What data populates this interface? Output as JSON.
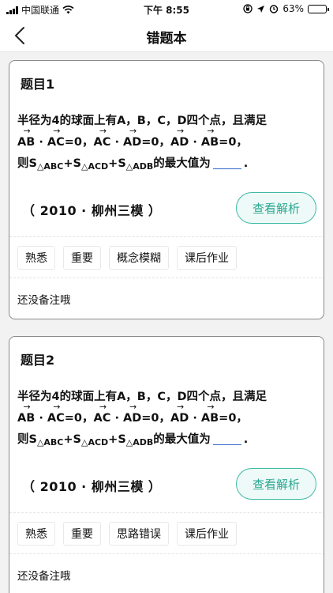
{
  "status_bar": {
    "carrier": "中国联通",
    "time": "下午 8:55",
    "battery": "63%",
    "battery_level": 0.63
  },
  "nav": {
    "title": "错题本",
    "back_icon": "chevron-left-icon"
  },
  "questions": [
    {
      "title": "题目1",
      "line1": "半径为4的球面上有A，B，C，D四个点，且满足",
      "s_prefix": "则S",
      "s_plus": "+S",
      "tri_abc": "△ABC",
      "tri_acd": "△ACD",
      "tri_adb": "△ADB",
      "s_suffix": "的最大值为",
      "period": ".",
      "source": "（ 2010 · 柳州三模 ）",
      "button": "查看解析",
      "tags": [
        "熟悉",
        "重要",
        "概念模糊",
        "课后作业"
      ],
      "note": "还没备注哦"
    },
    {
      "title": "题目2",
      "line1": "半径为4的球面上有A，B，C，D四个点，且满足",
      "s_prefix": "则S",
      "s_plus": "+S",
      "tri_abc": "△ABC",
      "tri_acd": "△ACD",
      "tri_adb": "△ADB",
      "s_suffix": "的最大值为",
      "period": ".",
      "source": "（ 2010 · 柳州三模 ）",
      "button": "查看解析",
      "tags": [
        "熟悉",
        "重要",
        "思路错误",
        "课后作业"
      ],
      "note": "还没备注哦"
    }
  ],
  "vectors": {
    "ab": "AB",
    "ac": "AC",
    "ad": "AD",
    "dot": " · ",
    "eq0": "=0，",
    "eq0_last": "=0，"
  }
}
